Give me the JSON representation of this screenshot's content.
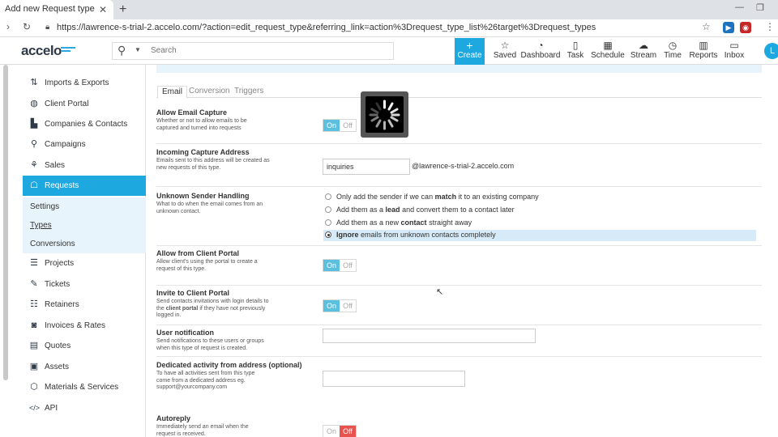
{
  "browser": {
    "tab_title": "Add new Request type",
    "url": "https://lawrence-s-trial-2.accelo.com/?action=edit_request_type&referring_link=action%3Drequest_type_list%26target%3Drequest_types"
  },
  "header": {
    "logo": "accelo",
    "search_placeholder": "Search",
    "create_label": "Create",
    "nav": [
      {
        "label": "Saved",
        "icon": "star-icon"
      },
      {
        "label": "Dashboard",
        "icon": "gauge-icon"
      },
      {
        "label": "Task",
        "icon": "clipboard-icon"
      },
      {
        "label": "Schedule",
        "icon": "calendar-icon"
      },
      {
        "label": "Stream",
        "icon": "chat-icon"
      },
      {
        "label": "Time",
        "icon": "clock-icon"
      },
      {
        "label": "Reports",
        "icon": "bar-chart-icon"
      },
      {
        "label": "Inbox",
        "icon": "inbox-icon"
      }
    ],
    "avatar": "L"
  },
  "sidebar": {
    "items": [
      {
        "label": "Imports & Exports",
        "icon": "import-export-icon"
      },
      {
        "label": "Client Portal",
        "icon": "globe-icon"
      },
      {
        "label": "Companies & Contacts",
        "icon": "buildings-icon"
      },
      {
        "label": "Campaigns",
        "icon": "campaign-icon"
      },
      {
        "label": "Sales",
        "icon": "sales-icon"
      },
      {
        "label": "Requests",
        "icon": "requests-icon"
      },
      {
        "label": "Projects",
        "icon": "projects-icon"
      },
      {
        "label": "Tickets",
        "icon": "ticket-icon"
      },
      {
        "label": "Retainers",
        "icon": "retainer-icon"
      },
      {
        "label": "Invoices & Rates",
        "icon": "invoice-icon"
      },
      {
        "label": "Quotes",
        "icon": "quote-icon"
      },
      {
        "label": "Assets",
        "icon": "assets-icon"
      },
      {
        "label": "Materials & Services",
        "icon": "materials-icon"
      },
      {
        "label": "API",
        "icon": "code-icon"
      }
    ],
    "sub_items": [
      "Settings",
      "Types",
      "Conversions"
    ]
  },
  "tabs": [
    "Email",
    "Conversion",
    "Triggers"
  ],
  "form": {
    "email_capture": {
      "label": "Allow Email Capture",
      "desc": "Whether or not to allow emails to be captured and turned into requests",
      "on": "On",
      "off": "Off",
      "state": "on"
    },
    "capture_address": {
      "label": "Incoming Capture Address",
      "desc": "Emails sent to this address will be created as new requests of this type.",
      "value": "inquiries",
      "domain": "@lawrence-s-trial-2.accelo.com"
    },
    "unknown_sender": {
      "label": "Unknown Sender Handling",
      "desc": "What to do when the email comes from an unknown contact.",
      "options": [
        {
          "pre": "Only add the sender if we can ",
          "bold": "match",
          "post": " it to an existing company"
        },
        {
          "pre": "Add them as a ",
          "bold": "lead",
          "post": " and convert them to a contact later"
        },
        {
          "pre": "Add them as a new ",
          "bold": "contact",
          "post": " straight away"
        },
        {
          "pre": "",
          "bold": "Ignore",
          "post": " emails from unknown contacts completely"
        }
      ],
      "selected_index": 3
    },
    "client_portal": {
      "label": "Allow from Client Portal",
      "desc": "Allow client's using the portal to create a request of this type.",
      "on": "On",
      "off": "Off",
      "state": "on"
    },
    "invite_portal": {
      "label": "Invite to Client Portal",
      "desc_pre": "Send contacts invitations with login details to the ",
      "desc_bold": "client portal",
      "desc_post": " if they have not previously logged in.",
      "on": "On",
      "off": "Off",
      "state": "on"
    },
    "user_notification": {
      "label": "User notification",
      "desc": "Send notifications to these users or groups when this type of request is created.",
      "value": ""
    },
    "dedicated_from": {
      "label": "Dedicated activity from address (optional)",
      "desc": "To have all activities sent from this type come from a dedicated address eg. support@yourcompany.com",
      "value": ""
    },
    "autoreply": {
      "label": "Autoreply",
      "desc": "Immediately send an email when the request is received.",
      "on": "On",
      "off": "Off",
      "state": "off"
    }
  }
}
